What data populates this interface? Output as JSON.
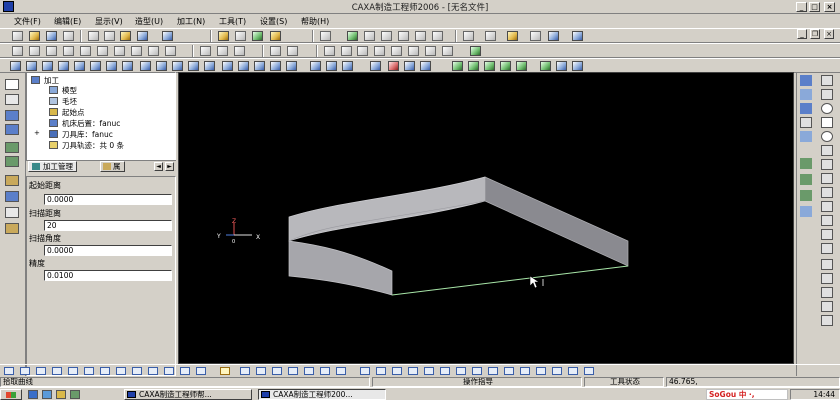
{
  "window": {
    "title": "CAXA制造工程师2006 - [无名文件]",
    "minimize_glyph": "_",
    "maximize_glyph": "□",
    "close_glyph": "×",
    "restore_glyph": "❐"
  },
  "menu": {
    "items": [
      "文件(F)",
      "编辑(E)",
      "显示(V)",
      "造型(U)",
      "加工(N)",
      "工具(T)",
      "设置(S)",
      "帮助(H)"
    ]
  },
  "tree": {
    "items": [
      {
        "label": "加工",
        "icon": "machining-icon"
      },
      {
        "label": "模型",
        "icon": "model-icon"
      },
      {
        "label": "毛坯",
        "icon": "blank-icon"
      },
      {
        "label": "起始点",
        "icon": "start-point-icon"
      },
      {
        "label": "机床后置：fanuc",
        "icon": "machine-post-icon"
      },
      {
        "label": "刀具库：fanuc",
        "icon": "tool-library-icon"
      },
      {
        "label": "刀具轨迹：共 0 条",
        "icon": "toolpath-folder-icon"
      }
    ],
    "expand_glyph": "+",
    "tabs": {
      "machining": "加工管理",
      "attributes": "属"
    },
    "nav_prev": "◄",
    "nav_next": "►"
  },
  "params": [
    {
      "label": "起始距离",
      "value": "0.0000"
    },
    {
      "label": "扫描距离",
      "value": "20"
    },
    {
      "label": "扫描角度",
      "value": "0.0000"
    },
    {
      "label": "精度",
      "value": "0.0100"
    }
  ],
  "viewport": {
    "axes": {
      "z": "Z",
      "y": "Y",
      "x": "X",
      "origin": "0"
    }
  },
  "status": {
    "prompt": "拾取曲线",
    "operation_hint": "操作指导",
    "tool_state": "工具状态",
    "coordinates": "46.765,"
  },
  "taskbar": {
    "tasks": [
      {
        "label": "CAXA制造工程师帮...",
        "active": false
      },
      {
        "label": "CAXA制造工程师200...",
        "active": true
      }
    ],
    "ime": "SoGou 中 ·, ",
    "time": "14:44"
  },
  "colors": {
    "viewport_bg": "#000000",
    "surface_fill": "#c8c8cc",
    "surface_dark": "#8a8a90",
    "selected_curve": "#a8e6a8",
    "title_icon": "#1f3fa8"
  }
}
